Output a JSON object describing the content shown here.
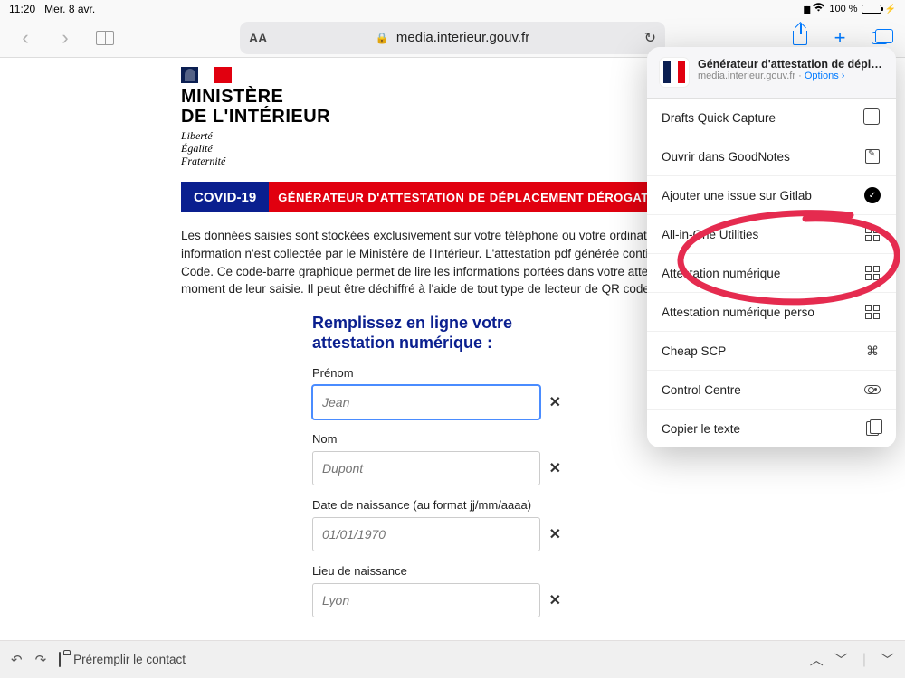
{
  "status": {
    "time": "11:20",
    "date": "Mer. 8 avr.",
    "battery_text": "100 %"
  },
  "toolbar": {
    "aa_label": "AA",
    "url_display": "media.interieur.gouv.fr"
  },
  "page": {
    "ministry_line1": "MINISTÈRE",
    "ministry_line2": "DE L'INTÉRIEUR",
    "motto_line1": "Liberté",
    "motto_line2": "Égalité",
    "motto_line3": "Fraternité",
    "banner_left": "COVID-19",
    "banner_right": "GÉNÉRATEUR D'ATTESTATION DE DÉPLACEMENT DÉROGATOI",
    "desc": "Les données saisies sont stockées exclusivement sur votre téléphone ou votre ordinateur. Aucune information n'est collectée par le Ministère de l'Intérieur. L'attestation pdf générée contient un QR Code. Ce code-barre graphique permet de lire les informations portées dans votre attestation au moment de leur saisie. Il peut être déchiffré à l'aide de tout type de lecteur de QR code générique.",
    "form_title_l1": "Remplissez en ligne votre",
    "form_title_l2": "attestation numérique :",
    "fields": {
      "prenom": {
        "label": "Prénom",
        "placeholder": "Jean"
      },
      "nom": {
        "label": "Nom",
        "placeholder": "Dupont"
      },
      "dob": {
        "label": "Date de naissance (au format jj/mm/aaaa)",
        "placeholder": "01/01/1970"
      },
      "lieu": {
        "label": "Lieu de naissance",
        "placeholder": "Lyon"
      }
    }
  },
  "share": {
    "title": "Générateur d'attestation de déplacement dérog…",
    "subtitle_host": "media.interieur.gouv.fr",
    "options_label": "Options",
    "items": [
      {
        "label": "Drafts Quick Capture",
        "icon": "draft"
      },
      {
        "label": "Ouvrir dans GoodNotes",
        "icon": "note"
      },
      {
        "label": "Ajouter une issue sur Gitlab",
        "icon": "check"
      },
      {
        "label": "All-in-One Utilities",
        "icon": "grid"
      },
      {
        "label": "Attestation numérique",
        "icon": "qr"
      },
      {
        "label": "Attestation numérique perso",
        "icon": "qr"
      },
      {
        "label": "Cheap SCP",
        "icon": "text"
      },
      {
        "label": "Control Centre",
        "icon": "cc"
      },
      {
        "label": "Copier le texte",
        "icon": "copy"
      }
    ]
  },
  "shortcut_bar": {
    "label": "Préremplir le contact"
  }
}
